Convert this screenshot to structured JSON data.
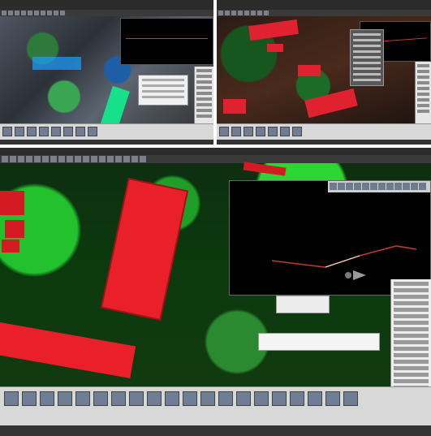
{
  "panels": {
    "top_left": {
      "title": ""
    },
    "top_right": {
      "title": ""
    },
    "bottom": {
      "title": ""
    }
  },
  "colors": {
    "building_roof": "#e9202a",
    "vegetation": "#24c12e",
    "profile_line": "#c0392b",
    "profile_background": "#000000",
    "ui_chrome": "#d8d8d8"
  },
  "icons": {
    "toolbar": "tool-icon",
    "ribbon": "ribbon-tool-icon",
    "profile_cursor": "arrow-right-icon"
  }
}
